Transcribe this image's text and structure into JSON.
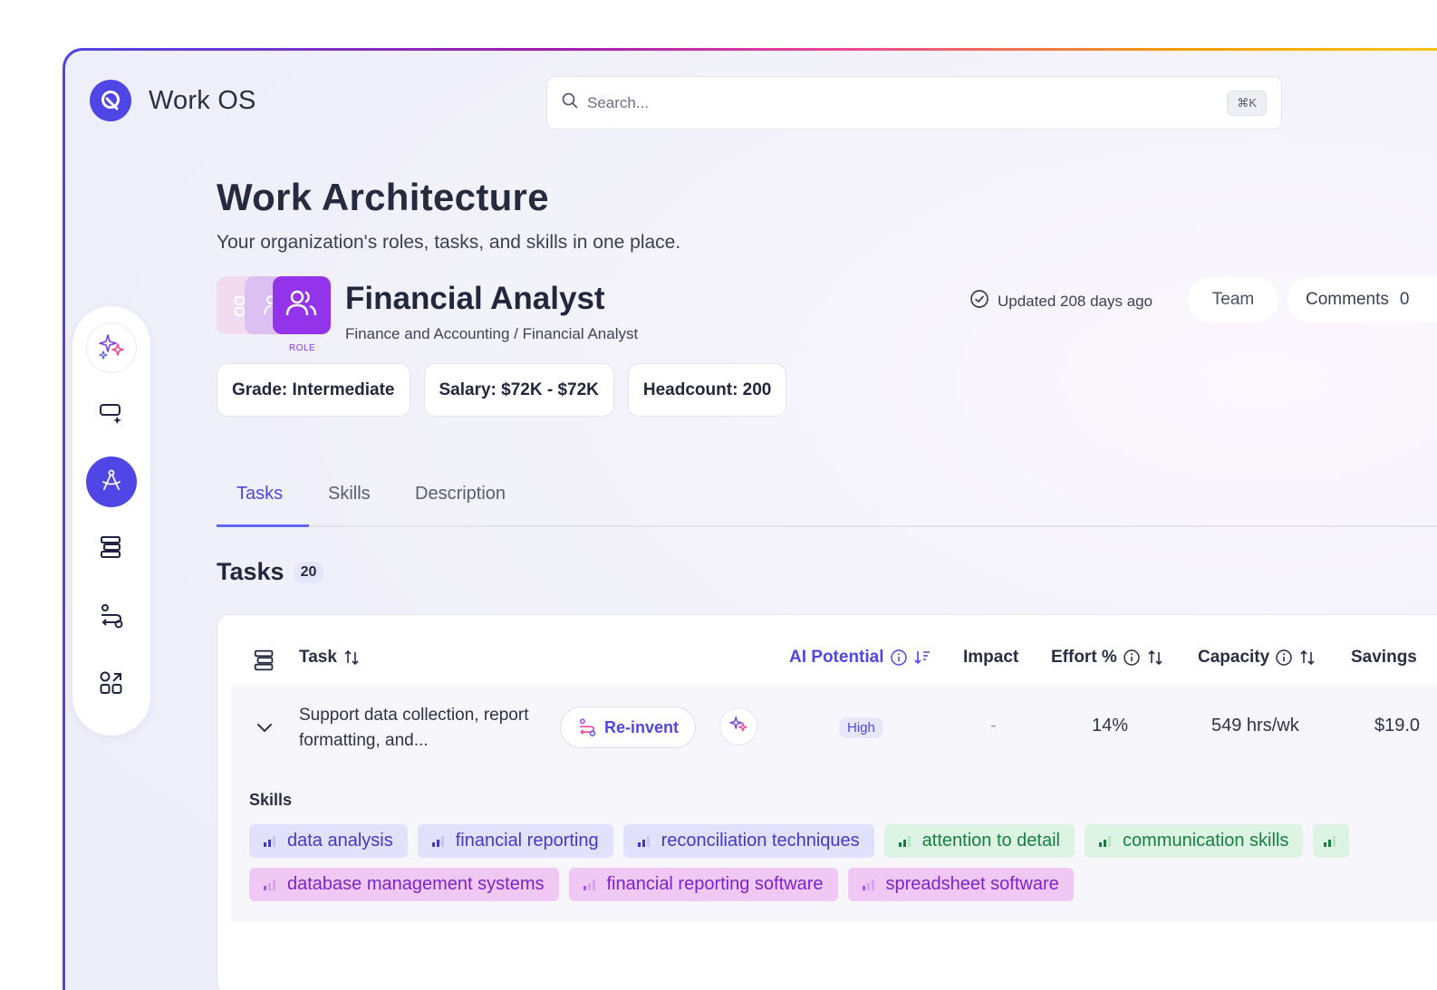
{
  "app": {
    "name": "Work OS"
  },
  "search": {
    "placeholder": "Search...",
    "shortcut": "⌘K"
  },
  "rail": {
    "items": [
      {
        "icon": "sparkle-icon"
      },
      {
        "icon": "screen-edit-icon"
      },
      {
        "icon": "compass-icon",
        "active": true
      },
      {
        "icon": "stack-icon"
      },
      {
        "icon": "workflow-icon"
      },
      {
        "icon": "apps-grid-icon"
      }
    ]
  },
  "page": {
    "title": "Work Architecture",
    "subtitle": "Your organization's roles, tasks, and skills in one place."
  },
  "role": {
    "tag": "ROLE",
    "name": "Financial Analyst",
    "breadcrumb": "Finance and Accounting / Financial Analyst",
    "updated": "Updated 208 days ago",
    "team_label": "Team",
    "comments_label": "Comments",
    "comments_count": "0",
    "chips": {
      "grade": "Grade: Intermediate",
      "salary": "Salary: $72K - $72K",
      "headcount": "Headcount: 200"
    }
  },
  "tabs": {
    "tasks": "Tasks",
    "skills": "Skills",
    "description": "Description"
  },
  "tasks_section": {
    "title": "Tasks",
    "count": "20",
    "columns": {
      "task": "Task",
      "ai_potential": "AI Potential",
      "impact": "Impact",
      "effort": "Effort %",
      "capacity": "Capacity",
      "savings": "Savings"
    },
    "row": {
      "task_text": "Support data collection, report formatting, and...",
      "reinvent_label": "Re-invent",
      "ai_potential": "High",
      "impact": "-",
      "effort": "14%",
      "capacity": "549 hrs/wk",
      "savings": "$19.0"
    },
    "skills_label": "Skills",
    "skills_row1": [
      "data analysis",
      "financial reporting",
      "reconciliation techniques",
      "attention to detail",
      "communication skills"
    ],
    "skills_row2": [
      "database management systems",
      "financial reporting software",
      "spreadsheet software"
    ]
  },
  "colors": {
    "accent": "#4f46e5",
    "blue_skill": "#e2e1fb",
    "green_skill": "#ddf4e4",
    "purple_skill": "#efc9f3"
  }
}
